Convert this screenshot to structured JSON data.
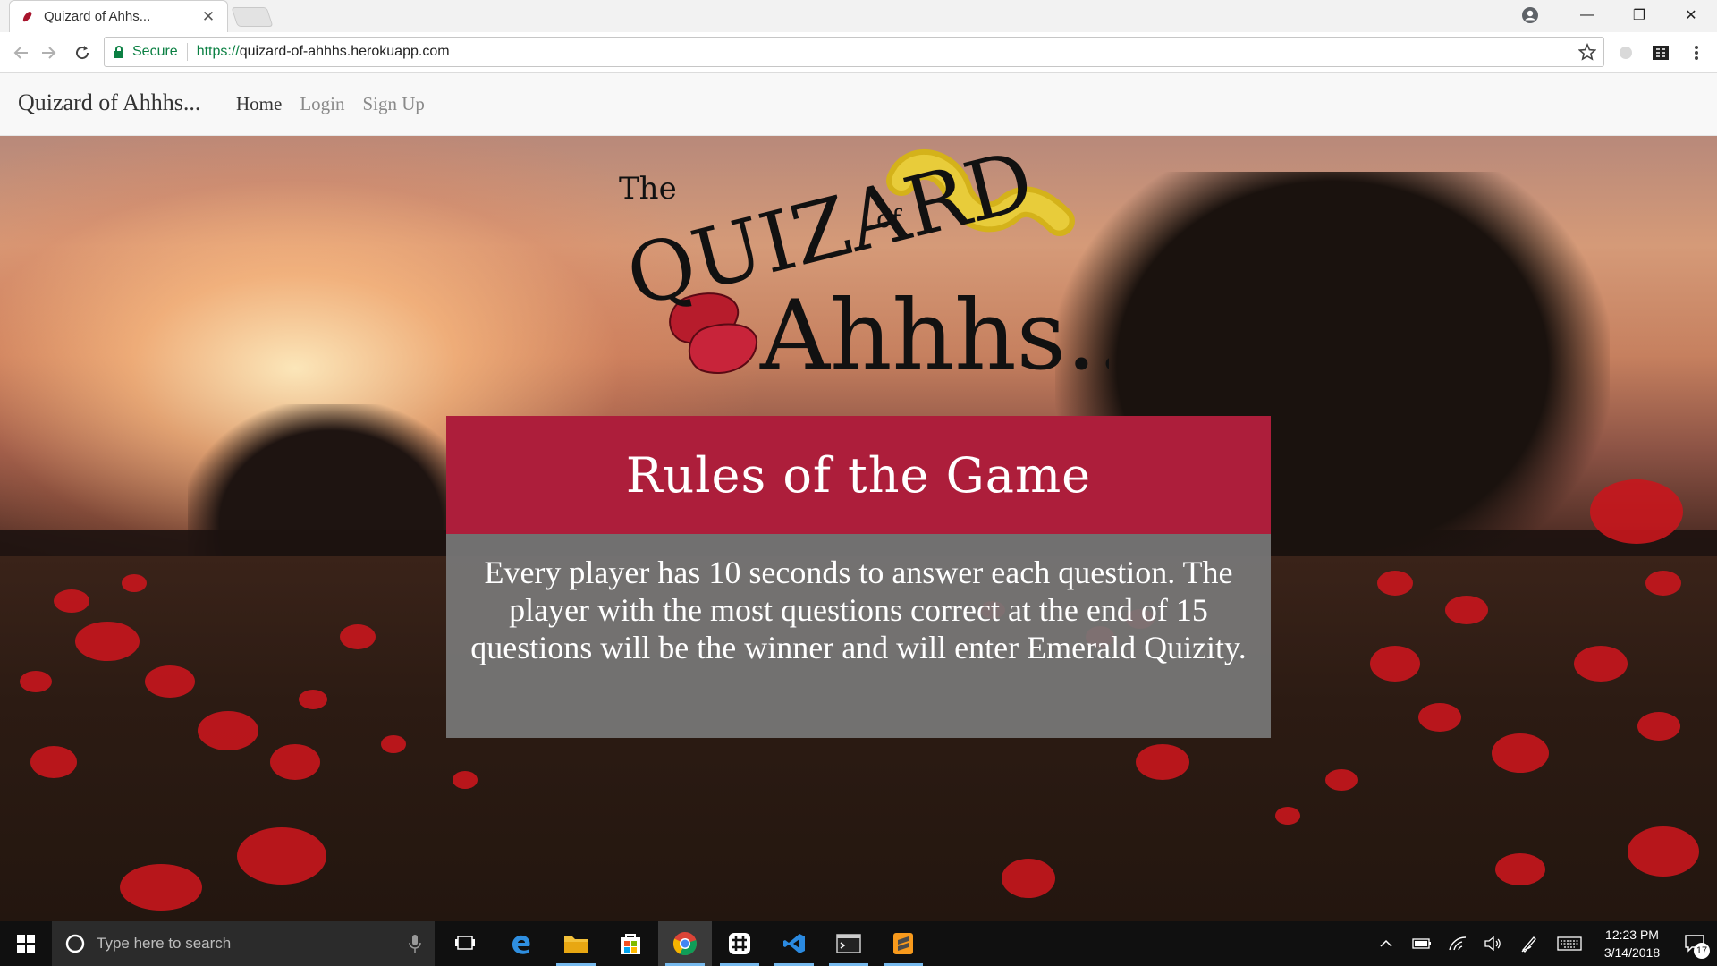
{
  "browser": {
    "tab_title": "Quizard of Ahhs...",
    "address": {
      "secure_label": "Secure",
      "url_scheme": "https://",
      "url_host": "quizard-of-ahhhs.herokuapp.com"
    }
  },
  "site": {
    "brand": "Quizard of Ahhhs...",
    "nav": [
      {
        "label": "Home",
        "state": "active"
      },
      {
        "label": "Login",
        "state": "inactive"
      },
      {
        "label": "Sign Up",
        "state": "inactive"
      }
    ],
    "logo": {
      "the": "The",
      "quizard": "QUIZARD",
      "of": "of",
      "ahhhs": "Ahhhs..."
    },
    "rules": {
      "title": "Rules of the Game",
      "body": "Every player has 10 seconds to answer each question. The player with the most questions correct at the end of 15 questions will be the winner and will enter Emerald Quizity."
    },
    "colors": {
      "rules_header": "#ad1e3b",
      "rules_body": "#787878"
    }
  },
  "taskbar": {
    "search_placeholder": "Type here to search",
    "time": "12:23 PM",
    "date": "3/14/2018",
    "notification_count": "17",
    "apps": [
      "task-view",
      "edge",
      "file-explorer",
      "store",
      "chrome",
      "slack",
      "vscode",
      "terminal",
      "sublime-text"
    ]
  }
}
